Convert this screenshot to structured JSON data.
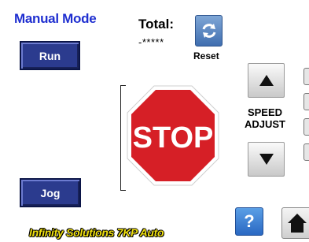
{
  "mode": {
    "title": "Manual Mode"
  },
  "buttons": {
    "run": "Run",
    "jog": "Jog",
    "reset": "Reset",
    "help": "?"
  },
  "total": {
    "label": "Total:",
    "value": "-*****"
  },
  "stop_sign": {
    "text": "STOP"
  },
  "speed": {
    "label_line1": "SPEED",
    "label_line2": "ADJUST"
  },
  "brand": {
    "text": "Infinity Solutions 7KP Auto"
  },
  "colors": {
    "mode_title": "#1f2fd0",
    "navy_button": "#2b3b8e",
    "stop_red": "#d61f26",
    "brand_yellow": "#f0e010"
  },
  "icons": [
    "refresh-icon",
    "stop-sign-icon",
    "arrow-up-icon",
    "arrow-down-icon",
    "help-icon",
    "home-icon"
  ]
}
